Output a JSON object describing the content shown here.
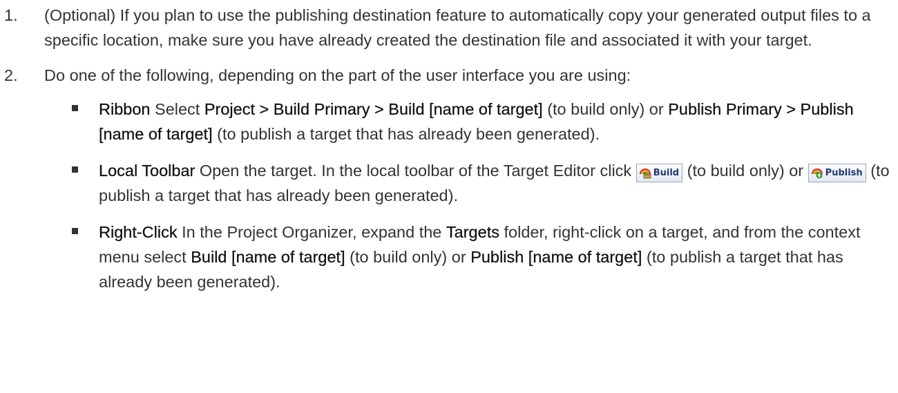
{
  "steps": [
    {
      "number": "1.",
      "text": "(Optional) If you plan to use the publishing destination feature to automatically copy your generated output files to a specific location, make sure you have already created the destination file and associated it with your target."
    },
    {
      "number": "2.",
      "text": "Do one of the following, depending on the part of the user interface you are using:",
      "bullets": {
        "ribbon": {
          "label": "Ribbon",
          "t1": " Select ",
          "b1": "Project > Build Primary > Build [name of target]",
          "t2": " (to build only) or ",
          "b2": "Publish Primary > Publish [name of target]",
          "t3": " (to publish a target that has already been generated)."
        },
        "local_toolbar": {
          "label": "Local Toolbar",
          "t1": " Open the target. In the local toolbar of the Target Editor click ",
          "build_button": "Build",
          "t2": " (to build only) or ",
          "publish_button": "Publish",
          "t3": " (to publish a target that has already been generated)."
        },
        "right_click": {
          "label": "Right-Click",
          "t1": " In the Project Organizer, expand the ",
          "b1": "Targets",
          "t2": " folder, right-click on a target, and from the context menu select ",
          "b2": "Build [name of target]",
          "t3": " (to build only) or ",
          "b3": "Publish [name of target]",
          "t4": " (to publish a target that has already been generated)."
        }
      }
    }
  ],
  "icons": {
    "build": "build-target-icon",
    "publish": "publish-target-icon"
  },
  "colors": {
    "text": "#333333",
    "button_text": "#1f3b6f",
    "icon_red": "#d9362b",
    "icon_gold": "#e2a21f",
    "icon_green": "#3f9a2c"
  }
}
